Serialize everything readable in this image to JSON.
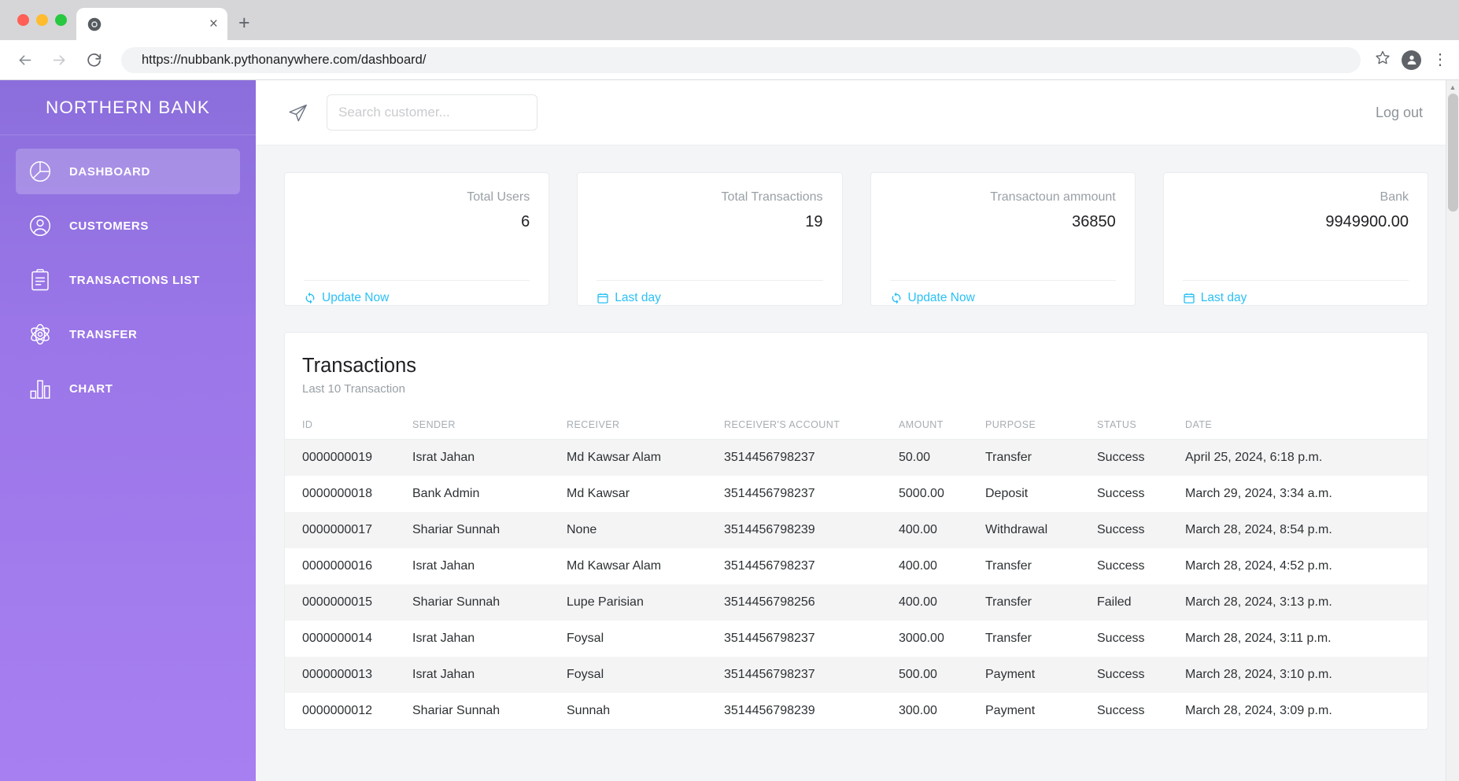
{
  "browser": {
    "tab_title": "",
    "favicon": "chrome-icon",
    "close_label": "×",
    "newtab_label": "+",
    "back_icon": "back-arrow-icon",
    "forward_icon": "forward-arrow-icon",
    "reload_icon": "reload-icon",
    "url": "https://nubbank.pythonanywhere.com/dashboard/",
    "bookmark_icon": "star-icon",
    "profile_icon": "profile-avatar-icon",
    "menu_icon": "kebab-menu-icon"
  },
  "sidebar": {
    "brand": "NORTHERN BANK",
    "items": [
      {
        "label": "DASHBOARD",
        "icon": "pie-chart-icon",
        "active": true
      },
      {
        "label": "CUSTOMERS",
        "icon": "user-circle-icon",
        "active": false
      },
      {
        "label": "TRANSACTIONS LIST",
        "icon": "clipboard-list-icon",
        "active": false
      },
      {
        "label": "TRANSFER",
        "icon": "atom-icon",
        "active": false
      },
      {
        "label": "CHART",
        "icon": "bar-chart-icon",
        "active": false
      }
    ]
  },
  "topbar": {
    "send_icon": "send-paper-plane-icon",
    "search_placeholder": "Search customer...",
    "search_value": "",
    "logout_label": "Log out"
  },
  "cards": [
    {
      "label": "Total Users",
      "value": "6",
      "action_label": "Update Now",
      "action_icon": "refresh-icon"
    },
    {
      "label": "Total Transactions",
      "value": "19",
      "action_label": "Last day",
      "action_icon": "calendar-icon"
    },
    {
      "label": "Transactoun ammount",
      "value": "36850",
      "action_label": "Update Now",
      "action_icon": "refresh-icon"
    },
    {
      "label": "Bank",
      "value": "9949900.00",
      "action_label": "Last day",
      "action_icon": "calendar-icon"
    }
  ],
  "panel": {
    "title": "Transactions",
    "subtitle": "Last 10 Transaction",
    "columns": [
      "ID",
      "SENDER",
      "RECEIVER",
      "RECEIVER'S ACCOUNT",
      "AMOUNT",
      "PURPOSE",
      "STATUS",
      "DATE"
    ],
    "rows": [
      [
        "0000000019",
        "Israt Jahan",
        "Md Kawsar Alam",
        "3514456798237",
        "50.00",
        "Transfer",
        "Success",
        "April 25, 2024, 6:18 p.m."
      ],
      [
        "0000000018",
        "Bank Admin",
        "Md Kawsar",
        "3514456798237",
        "5000.00",
        "Deposit",
        "Success",
        "March 29, 2024, 3:34 a.m."
      ],
      [
        "0000000017",
        "Shariar Sunnah",
        "None",
        "3514456798239",
        "400.00",
        "Withdrawal",
        "Success",
        "March 28, 2024, 8:54 p.m."
      ],
      [
        "0000000016",
        "Israt Jahan",
        "Md Kawsar Alam",
        "3514456798237",
        "400.00",
        "Transfer",
        "Success",
        "March 28, 2024, 4:52 p.m."
      ],
      [
        "0000000015",
        "Shariar Sunnah",
        "Lupe Parisian",
        "3514456798256",
        "400.00",
        "Transfer",
        "Failed",
        "March 28, 2024, 3:13 p.m."
      ],
      [
        "0000000014",
        "Israt Jahan",
        "Foysal",
        "3514456798237",
        "3000.00",
        "Transfer",
        "Success",
        "March 28, 2024, 3:11 p.m."
      ],
      [
        "0000000013",
        "Israt Jahan",
        "Foysal",
        "3514456798237",
        "500.00",
        "Payment",
        "Success",
        "March 28, 2024, 3:10 p.m."
      ],
      [
        "0000000012",
        "Shariar Sunnah",
        "Sunnah",
        "3514456798239",
        "300.00",
        "Payment",
        "Success",
        "March 28, 2024, 3:09 p.m."
      ]
    ]
  },
  "scrollbar": {
    "up_arrow": "▲",
    "down_arrow": "▼"
  },
  "colors": {
    "sidebar_top": "#8b6edb",
    "sidebar_bottom": "#a87ff0",
    "link_cyan": "#2bc0f5",
    "page_bg": "#f4f5f7"
  }
}
